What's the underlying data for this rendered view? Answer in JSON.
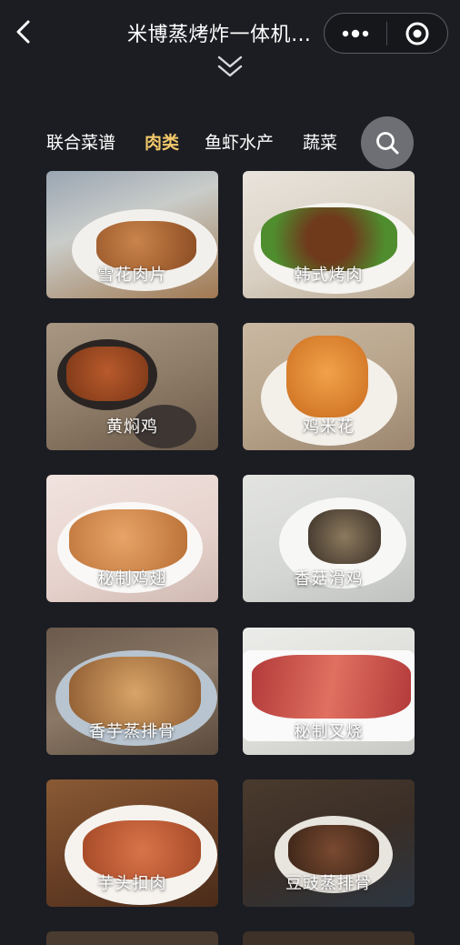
{
  "header": {
    "title": "米博蒸烤炸一体机…",
    "back_icon": "chevron-left-icon",
    "more_icon": "more-dots-icon",
    "close_icon": "target-close-icon",
    "expand_icon": "double-chevron-down-icon"
  },
  "tabs": [
    {
      "label": "联合菜谱",
      "active": false
    },
    {
      "label": "肉类",
      "active": true
    },
    {
      "label": "鱼虾水产",
      "active": false
    },
    {
      "label": "蔬菜",
      "active": false
    }
  ],
  "search_icon": "search-icon",
  "colors": {
    "background": "#1b1d22",
    "active_tab": "#f2c86a",
    "search_button": "#6d6f74"
  },
  "recipes": [
    {
      "name": "雪花肉片"
    },
    {
      "name": "韩式烤肉"
    },
    {
      "name": "黄焖鸡"
    },
    {
      "name": "鸡米花"
    },
    {
      "name": "秘制鸡翅"
    },
    {
      "name": "香菇滑鸡"
    },
    {
      "name": "香芋蒸排骨"
    },
    {
      "name": "秘制叉烧"
    },
    {
      "name": "芋头扣肉"
    },
    {
      "name": "豆豉蒸排骨"
    }
  ]
}
